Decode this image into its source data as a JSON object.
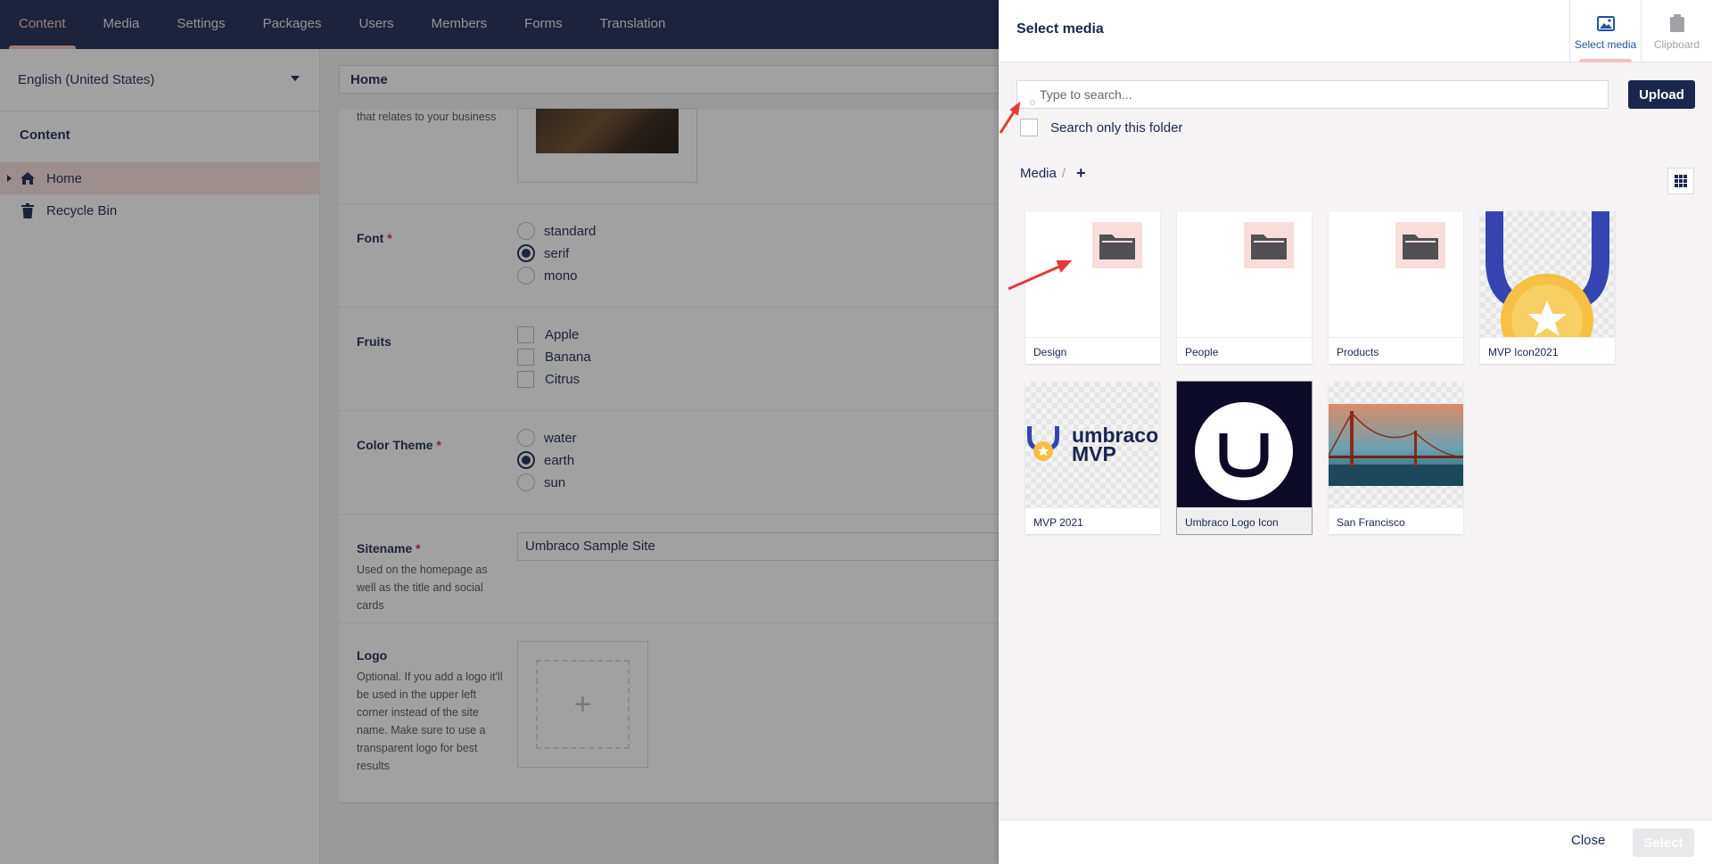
{
  "nav": {
    "items": [
      "Content",
      "Media",
      "Settings",
      "Packages",
      "Users",
      "Members",
      "Forms",
      "Translation"
    ],
    "active_index": 0
  },
  "tree": {
    "language": "English (United States)",
    "heading": "Content",
    "items": [
      {
        "label": "Home",
        "icon": "home-icon",
        "selected": true
      },
      {
        "label": "Recycle Bin",
        "icon": "trash-icon",
        "selected": false
      }
    ]
  },
  "editor": {
    "node_name": "Home",
    "partial_desc": "that relates to your business",
    "font": {
      "label": "Font",
      "required": "*",
      "options": [
        "standard",
        "serif",
        "mono"
      ],
      "selected": "serif"
    },
    "fruits": {
      "label": "Fruits",
      "options": [
        "Apple",
        "Banana",
        "Citrus"
      ]
    },
    "color_theme": {
      "label": "Color Theme",
      "required": "*",
      "options": [
        "water",
        "earth",
        "sun"
      ],
      "selected": "earth"
    },
    "sitename": {
      "label": "Sitename",
      "required": "*",
      "desc": "Used on the homepage as well as the title and social cards",
      "value": "Umbraco Sample Site"
    },
    "logo": {
      "label": "Logo",
      "desc": "Optional. If you add a logo it'll be used in the upper left corner instead of the site name. Make sure to use a transparent logo for best results",
      "add_symbol": "+"
    }
  },
  "dialog": {
    "title": "Select media",
    "tabs": [
      {
        "label": "Select media",
        "icon": "picture-icon",
        "active": true
      },
      {
        "label": "Clipboard",
        "icon": "clipboard-icon",
        "active": false
      }
    ],
    "search": {
      "placeholder": "Type to search..."
    },
    "upload_label": "Upload",
    "only_folder_label": "Search only this folder",
    "breadcrumb": {
      "root": "Media",
      "separator": "/",
      "add_symbol": "+"
    },
    "items": [
      {
        "name": "Design",
        "kind": "folder"
      },
      {
        "name": "People",
        "kind": "folder"
      },
      {
        "name": "Products",
        "kind": "folder"
      },
      {
        "name": "MVP Icon2021",
        "kind": "image"
      },
      {
        "name": "MVP 2021",
        "kind": "image",
        "logo_text": [
          "umbraco",
          "MVP"
        ]
      },
      {
        "name": "Umbraco Logo Icon",
        "kind": "image",
        "selected": true
      },
      {
        "name": "San Francisco",
        "kind": "image"
      }
    ],
    "footer": {
      "close_label": "Close",
      "select_label": "Select"
    }
  },
  "colors": {
    "brand_navy": "#1b264f",
    "accent_pink": "#f5c1bc",
    "selected_bg": "#f7dedb",
    "annotation_red": "#e53935"
  }
}
